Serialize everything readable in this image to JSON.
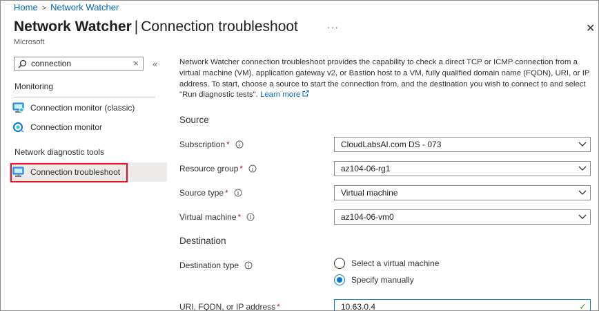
{
  "breadcrumb": {
    "home": "Home",
    "current": "Network Watcher"
  },
  "header": {
    "title_bold": "Network Watcher",
    "separator": "|",
    "title_rest": "Connection troubleshoot",
    "more": "···",
    "close": "✕",
    "subtitle": "Microsoft"
  },
  "sidebar": {
    "search_value": "connection",
    "clear": "×",
    "collapse": "«",
    "sections": [
      {
        "label": "Monitoring",
        "items": [
          {
            "label": "Connection monitor (classic)",
            "icon": "connection-monitor-classic-icon"
          },
          {
            "label": "Connection monitor",
            "icon": "connection-monitor-icon"
          }
        ]
      },
      {
        "label": "Network diagnostic tools",
        "items": [
          {
            "label": "Connection troubleshoot",
            "icon": "connection-troubleshoot-icon",
            "selected": true
          }
        ]
      }
    ]
  },
  "main": {
    "description": "Network Watcher connection troubleshoot provides the capability to check a direct TCP or ICMP connection from a virtual machine (VM), application gateway v2, or Bastion host to a VM, fully qualified domain name (FQDN), URI, or IP address. To start, choose a source to start the connection from, and the destination you wish to connect to and select \"Run diagnostic tests\".",
    "learn_more": "Learn more",
    "source_heading": "Source",
    "fields": {
      "subscription": {
        "label": "Subscription",
        "value": "CloudLabsAI.com DS - 073"
      },
      "resource_group": {
        "label": "Resource group",
        "value": "az104-06-rg1"
      },
      "source_type": {
        "label": "Source type",
        "value": "Virtual machine"
      },
      "virtual_machine": {
        "label": "Virtual machine",
        "value": "az104-06-vm0"
      }
    },
    "destination_heading": "Destination",
    "destination_type": {
      "label": "Destination type",
      "options": [
        {
          "label": "Select a virtual machine",
          "checked": false
        },
        {
          "label": "Specify manually",
          "checked": true
        }
      ]
    },
    "address": {
      "label": "URI, FQDN, or IP address",
      "value": "10.63.0.4"
    }
  },
  "colors": {
    "accent": "#0078d4",
    "link": "#0067b8",
    "required": "#a4262c",
    "highlight_box": "#e81123",
    "valid": "#57a300"
  }
}
